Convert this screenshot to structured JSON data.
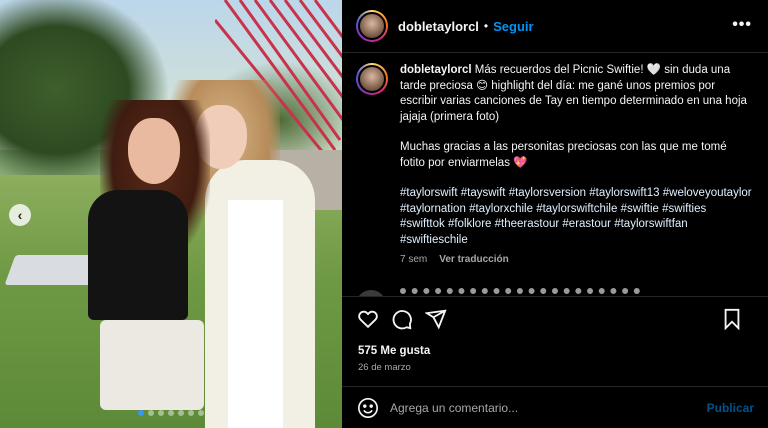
{
  "post": {
    "username": "dobletaylorcl",
    "follow_label": "Seguir",
    "separator": "•",
    "more_label": "•••",
    "carousel": {
      "current_slide": 1,
      "total_slides": 7,
      "prev_label": "‹"
    }
  },
  "caption": {
    "username": "dobletaylorcl",
    "line1_a": "Más recuerdos del Picnic Swiftie! ",
    "heart_white": "🤍",
    "line1_b": " sin duda una tarde preciosa ",
    "smile": "😊",
    "line1_c": " highlight del día: me gané unos premios por escribir varias canciones de Tay en tiempo determinado en una hoja jajaja (primera foto)",
    "line2": "Muchas gracias a las personitas preciosas con las que me tomé fotito por enviarmelas ",
    "heart_red": "💖",
    "hashtags": [
      "#taylorswift",
      "#tayswift",
      "#taylorsversion",
      "#taylorswift13",
      "#weloveyoutaylor",
      "#taylornation",
      "#taylorxchile",
      "#taylorswiftchile",
      "#swiftie",
      "#swifties",
      "#swifttok",
      "#folklore",
      "#theerastour",
      "#erastour",
      "#taylorswiftfan",
      "#swiftieschile"
    ],
    "age": "7 sem",
    "translate_label": "Ver traducción"
  },
  "engagement": {
    "likes": "575 Me gusta",
    "date": "26 de marzo"
  },
  "comment": {
    "placeholder": "Agrega un comentario...",
    "post_label": "Publicar"
  },
  "colors": {
    "accent": "#0095f6",
    "background": "#000000",
    "muted": "#a8a8a8",
    "hashtag": "#e0f1ff",
    "active_dot": "#3897f0"
  },
  "icons": {
    "like": "heart-icon",
    "comment": "comment-icon",
    "share": "share-icon",
    "save": "bookmark-icon",
    "emoji": "emoji-icon"
  }
}
